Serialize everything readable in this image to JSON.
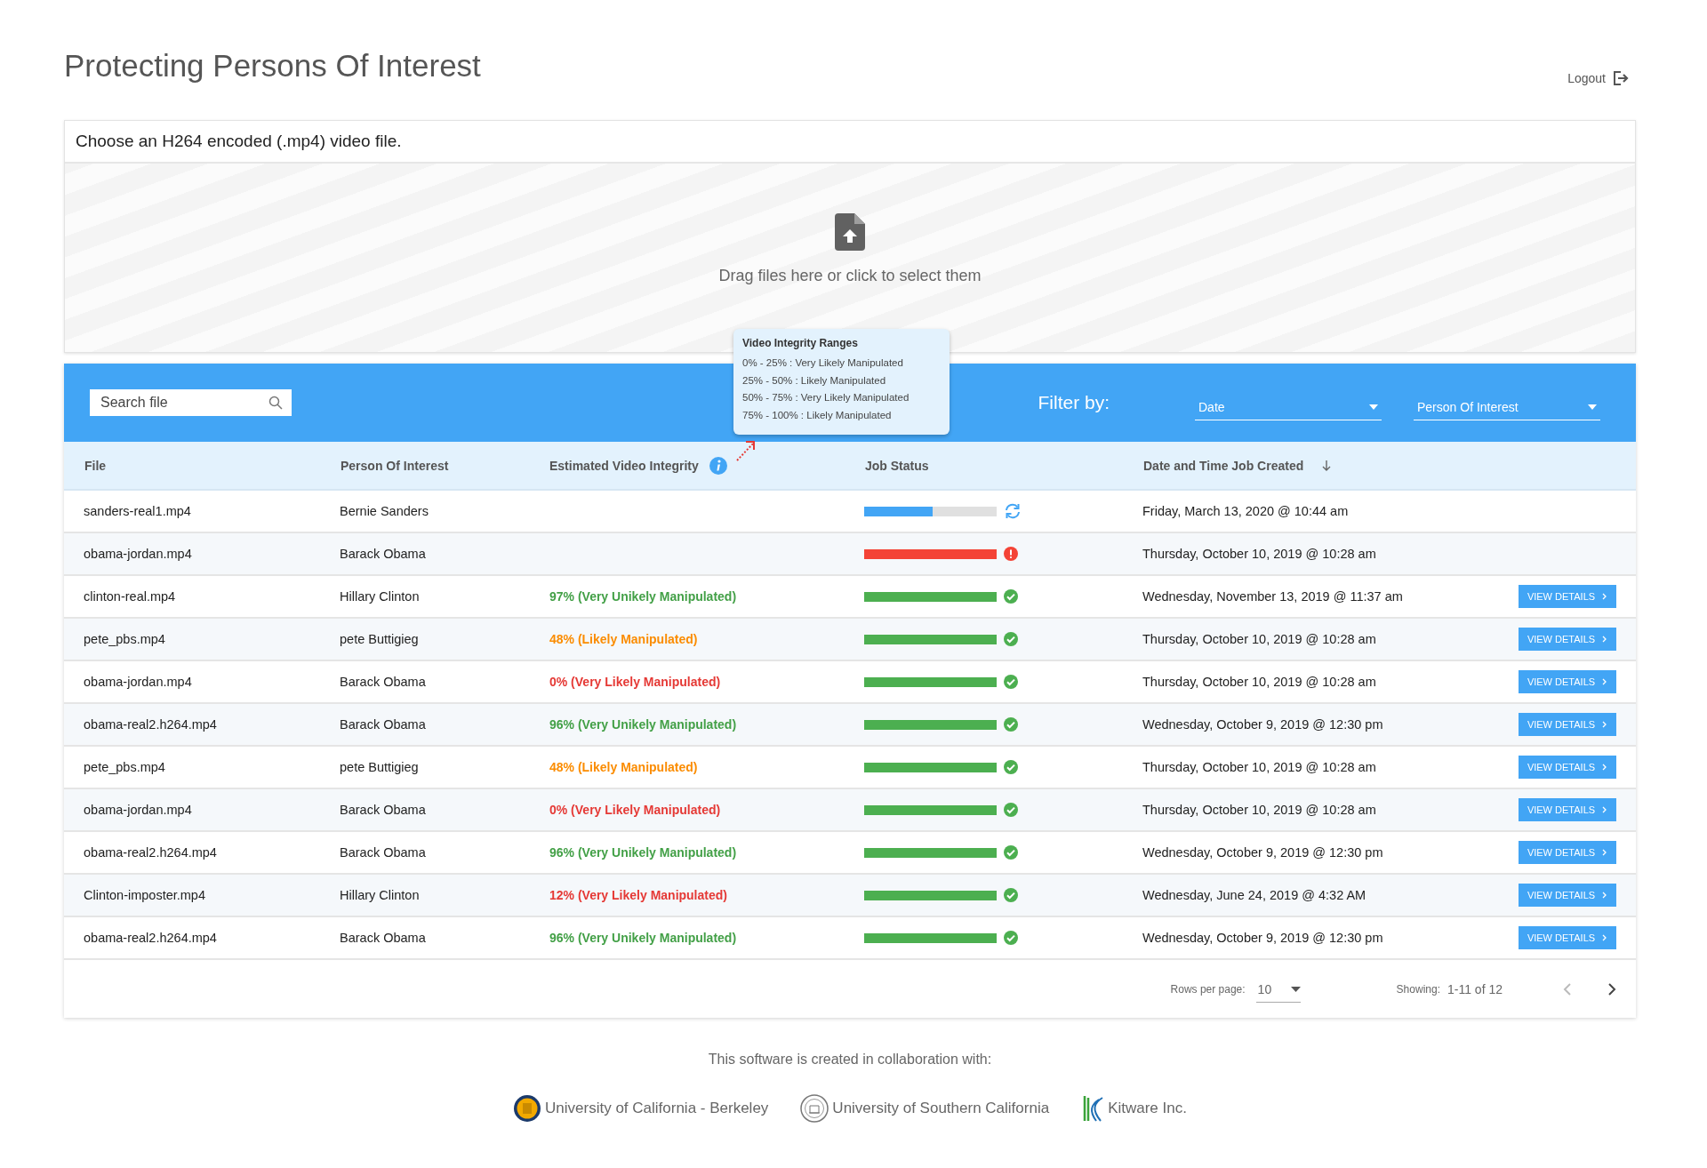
{
  "title": "Protecting Persons Of Interest",
  "logout": "Logout",
  "upload": {
    "heading": "Choose an H264 encoded (.mp4) video file.",
    "prompt": "Drag files here or click to select them"
  },
  "toolbar": {
    "search": {
      "placeholder": "Search file"
    },
    "filter_label": "Filter by:",
    "filters": [
      {
        "value": "Date"
      },
      {
        "value": "Person Of Interest"
      }
    ]
  },
  "tooltip": {
    "title": "Video Integrity Ranges",
    "lines": [
      "0% - 25% : Very Likely Manipulated",
      "25% - 50% : Likely Manipulated",
      "50% - 75% : Very Likely Manipulated",
      "75% - 100% : Likely Manipulated"
    ]
  },
  "table": {
    "columns": [
      "File",
      "Person Of Interest",
      "Estimated Video Integrity",
      "Job Status",
      "Date and Time Job Created"
    ],
    "rows": [
      {
        "file": "sanders-real1.mp4",
        "person": "Bernie Sanders",
        "job": {
          "kind": "running",
          "level": 0.52
        },
        "created": "Friday, March 13, 2020 @ 10:44 am"
      },
      {
        "file": "obama-jordan.mp4",
        "person": "Barack Obama",
        "job": {
          "kind": "failed",
          "level": 1
        },
        "created": "Thursday, October 10, 2019 @ 10:28 am"
      },
      {
        "file": "clinton-real.mp4",
        "person": "Hillary Clinton",
        "integrity": {
          "text": "97% (Very Unikely Manipulated)",
          "color": "#43a047"
        },
        "job": {
          "kind": "done",
          "level": 1
        },
        "created": "Wednesday, November 13, 2019 @ 11:37 am",
        "action": "VIEW DETAILS"
      },
      {
        "file": "pete_pbs.mp4",
        "person": "pete Buttigieg",
        "integrity": {
          "text": "48% (Likely Manipulated)",
          "color": "#fb8c00"
        },
        "job": {
          "kind": "done",
          "level": 1
        },
        "created": "Thursday, October 10, 2019 @ 10:28 am",
        "action": "VIEW DETAILS"
      },
      {
        "file": "obama-jordan.mp4",
        "person": "Barack Obama",
        "integrity": {
          "text": "0% (Very Likely Manipulated)",
          "color": "#e53935"
        },
        "job": {
          "kind": "done",
          "level": 1
        },
        "created": "Thursday, October 10, 2019 @ 10:28 am",
        "action": "VIEW DETAILS"
      },
      {
        "file": "obama-real2.h264.mp4",
        "person": "Barack Obama",
        "integrity": {
          "text": "96% (Very Unikely Manipulated)",
          "color": "#43a047"
        },
        "job": {
          "kind": "done",
          "level": 1
        },
        "created": "Wednesday, October 9, 2019 @ 12:30 pm",
        "action": "VIEW DETAILS"
      },
      {
        "file": "pete_pbs.mp4",
        "person": "pete Buttigieg",
        "integrity": {
          "text": "48% (Likely Manipulated)",
          "color": "#fb8c00"
        },
        "job": {
          "kind": "done",
          "level": 1
        },
        "created": "Thursday, October 10, 2019 @ 10:28 am",
        "action": "VIEW DETAILS"
      },
      {
        "file": "obama-jordan.mp4",
        "person": "Barack Obama",
        "integrity": {
          "text": "0% (Very Likely Manipulated)",
          "color": "#e53935"
        },
        "job": {
          "kind": "done",
          "level": 1
        },
        "created": "Thursday, October 10, 2019 @ 10:28 am",
        "action": "VIEW DETAILS"
      },
      {
        "file": "obama-real2.h264.mp4",
        "person": "Barack Obama",
        "integrity": {
          "text": "96% (Very Unikely Manipulated)",
          "color": "#43a047"
        },
        "job": {
          "kind": "done",
          "level": 1
        },
        "created": "Wednesday, October 9, 2019 @ 12:30 pm",
        "action": "VIEW DETAILS"
      },
      {
        "file": "Clinton-imposter.mp4",
        "person": "Hillary Clinton",
        "integrity": {
          "text": "12% (Very Likely Manipulated)",
          "color": "#e53935"
        },
        "job": {
          "kind": "done",
          "level": 1
        },
        "created": "Wednesday, June 24, 2019 @ 4:32 AM",
        "action": "VIEW DETAILS"
      },
      {
        "file": "obama-real2.h264.mp4",
        "person": "Barack Obama",
        "integrity": {
          "text": "96% (Very Unikely Manipulated)",
          "color": "#43a047"
        },
        "job": {
          "kind": "done",
          "level": 1
        },
        "created": "Wednesday, October 9, 2019 @ 12:30 pm",
        "action": "VIEW DETAILS"
      }
    ]
  },
  "pagination": {
    "rows_label": "Rows per page:",
    "rows_value": "10",
    "showing_label": "Showing:",
    "showing_value": "1-11 of 12"
  },
  "footer": {
    "note": "This software is created in collaboration with:",
    "partners": [
      {
        "name": "University of California - Berkeley",
        "kind": "seal-gold"
      },
      {
        "name": "University of Southern California",
        "kind": "seal-grey"
      },
      {
        "name": "Kitware Inc.",
        "kind": "stripes"
      }
    ]
  }
}
